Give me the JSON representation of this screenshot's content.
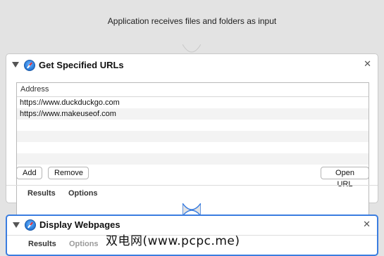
{
  "input_banner": {
    "text": "Application receives files and folders as input"
  },
  "action1": {
    "title": "Get Specified URLs",
    "icon": "safari-icon",
    "table": {
      "header": "Address",
      "rows": [
        "https://www.duckduckgo.com",
        "https://www.makeuseof.com",
        "",
        "",
        "",
        ""
      ]
    },
    "buttons": {
      "add": "Add",
      "remove": "Remove",
      "open_url": "Open URL"
    },
    "tabs": {
      "results": "Results",
      "options": "Options"
    }
  },
  "action2": {
    "title": "Display Webpages",
    "icon": "safari-icon",
    "tabs": {
      "results": "Results",
      "options": "Options"
    }
  },
  "watermark": "双电网(www.pcpc.me)",
  "colors": {
    "selected_border": "#3a7de0",
    "background": "#e3e3e3"
  }
}
